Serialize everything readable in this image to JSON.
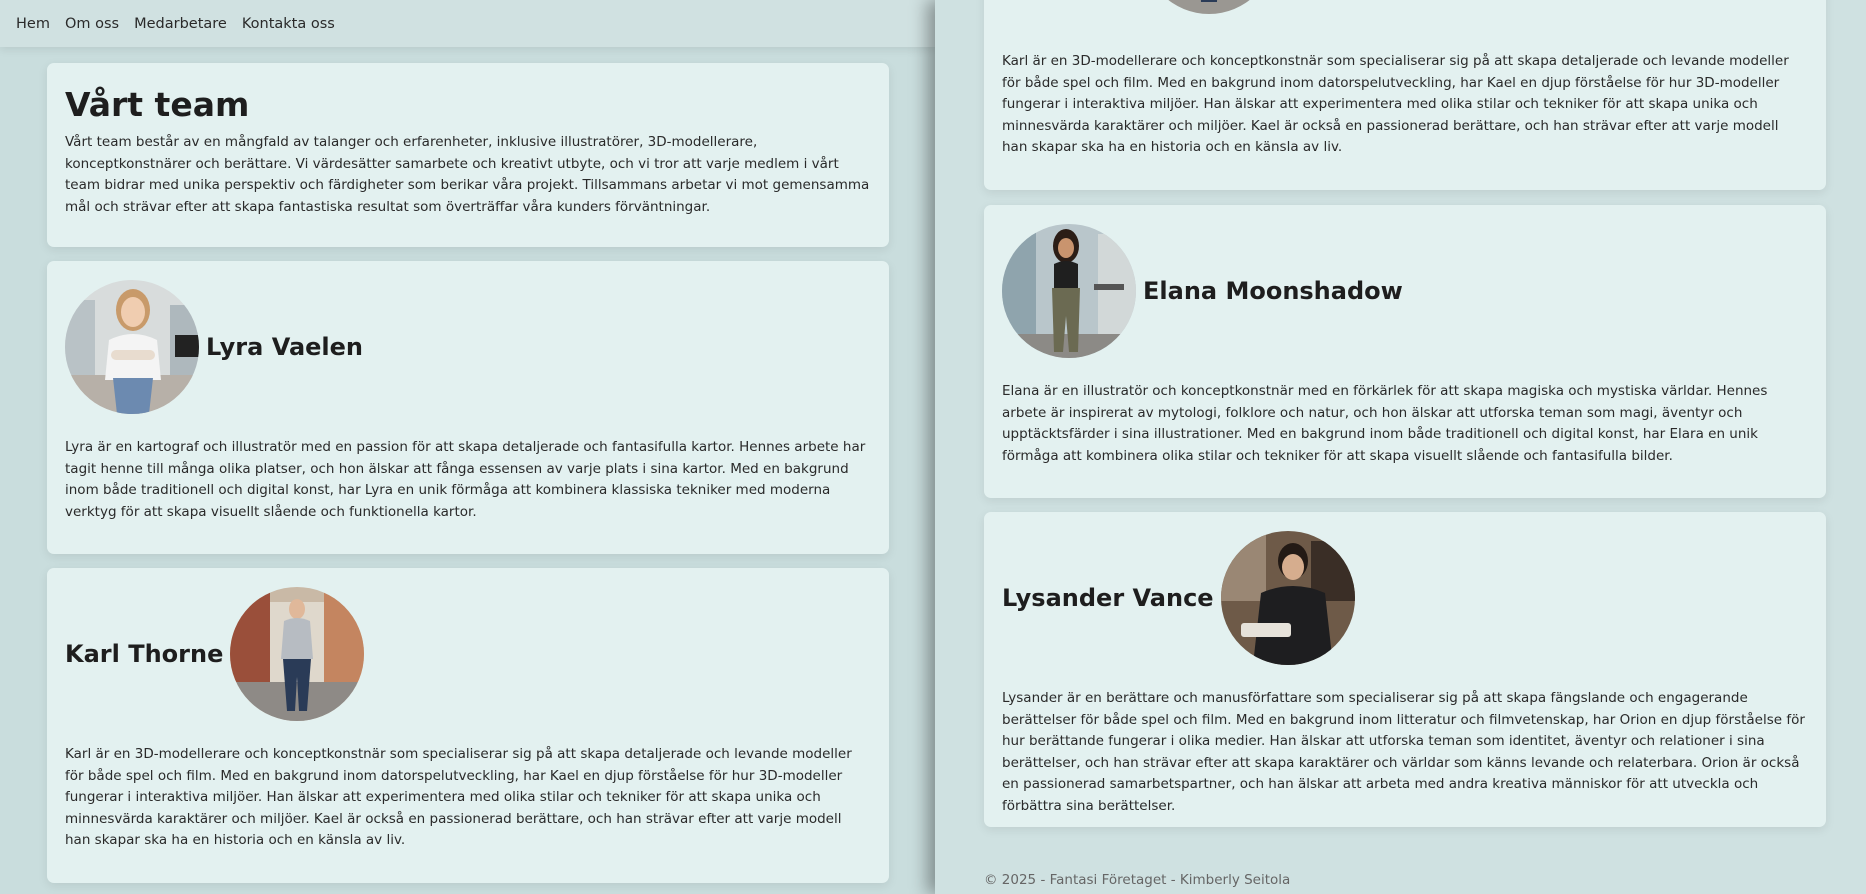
{
  "nav": {
    "items": [
      "Hem",
      "Om oss",
      "Medarbetare",
      "Kontakta oss"
    ]
  },
  "intro": {
    "title": "Vårt team",
    "text": "Vårt team består av en mångfald av talanger och erfarenheter, inklusive illustratörer, 3D-modellerare, konceptkonstnärer och berättare. Vi värdesätter samarbete och kreativt utbyte, och vi tror att varje medlem i vårt team bidrar med unika perspektiv och färdigheter som berikar våra projekt. Tillsammans arbetar vi mot gemensamma mål och strävar efter att skapa fantastiska resultat som överträffar våra kunders förväntningar."
  },
  "members": {
    "lyra": {
      "name": "Lyra Vaelen",
      "bio": "Lyra är en kartograf och illustratör med en passion för att skapa detaljerade och fantasifulla kartor. Hennes arbete har tagit henne till många olika platser, och hon älskar att fånga essensen av varje plats i sina kartor. Med en bakgrund inom både traditionell och digital konst, har Lyra en unik förmåga att kombinera klassiska tekniker med moderna verktyg för att skapa visuellt slående och funktionella kartor."
    },
    "karl": {
      "name": "Karl Thorne",
      "bio": "Karl är en 3D-modellerare och konceptkonstnär som specialiserar sig på att skapa detaljerade och levande modeller för både spel och film. Med en bakgrund inom datorspelutveckling, har Kael en djup förståelse för hur 3D-modeller fungerar i interaktiva miljöer. Han älskar att experimentera med olika stilar och tekniker för att skapa unika och minnesvärda karaktärer och miljöer. Kael är också en passionerad berättare, och han strävar efter att varje modell han skapar ska ha en historia och en känsla av liv."
    },
    "elana": {
      "name": "Elana Moonshadow",
      "bio": "Elana är en illustratör och konceptkonstnär med en förkärlek för att skapa magiska och mystiska världar. Hennes arbete är inspirerat av mytologi, folklore och natur, och hon älskar att utforska teman som magi, äventyr och upptäcktsfärder i sina illustrationer. Med en bakgrund inom både traditionell och digital konst, har Elara en unik förmåga att kombinera olika stilar och tekniker för att skapa visuellt slående och fantasifulla bilder."
    },
    "lysander": {
      "name": "Lysander Vance",
      "bio": "Lysander är en berättare och manusförfattare som specialiserar sig på att skapa fängslande och engagerande berättelser för både spel och film. Med en bakgrund inom litteratur och filmvetenskap, har Orion en djup förståelse för hur berättande fungerar i olika medier. Han älskar att utforska teman som identitet, äventyr och relationer i sina berättelser, och han strävar efter att skapa karaktärer och världar som känns levande och relaterbara. Orion är också en passionerad samarbetspartner, och han älskar att arbeta med andra kreativa människor för att utveckla och förbättra sina berättelser."
    }
  },
  "footer": {
    "text": "© 2025 - Fantasi Företaget - Kimberly Seitola"
  }
}
